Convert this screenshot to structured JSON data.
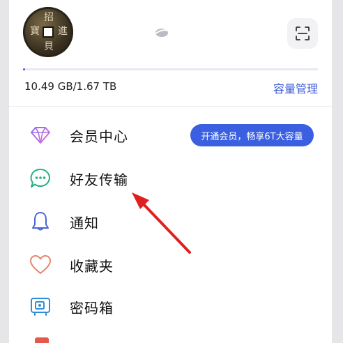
{
  "profile": {
    "avatar_chars": [
      "招",
      "進",
      "寶",
      "貝"
    ]
  },
  "storage": {
    "used_label": "10.49 GB/1.67 TB",
    "usage_fraction": 0.006,
    "manage_label": "容量管理"
  },
  "menu": {
    "items": [
      {
        "label": "会员中心",
        "icon": "diamond-icon",
        "badge": "开通会员，畅享6T大容量"
      },
      {
        "label": "好友传输",
        "icon": "chat-bubble-icon"
      },
      {
        "label": "通知",
        "icon": "bell-icon"
      },
      {
        "label": "收藏夹",
        "icon": "heart-icon"
      },
      {
        "label": "密码箱",
        "icon": "safe-icon"
      }
    ]
  },
  "colors": {
    "accent": "#3d5bd9",
    "badge_bg": "#3a5fe0",
    "annotation_arrow": "#e02020"
  }
}
